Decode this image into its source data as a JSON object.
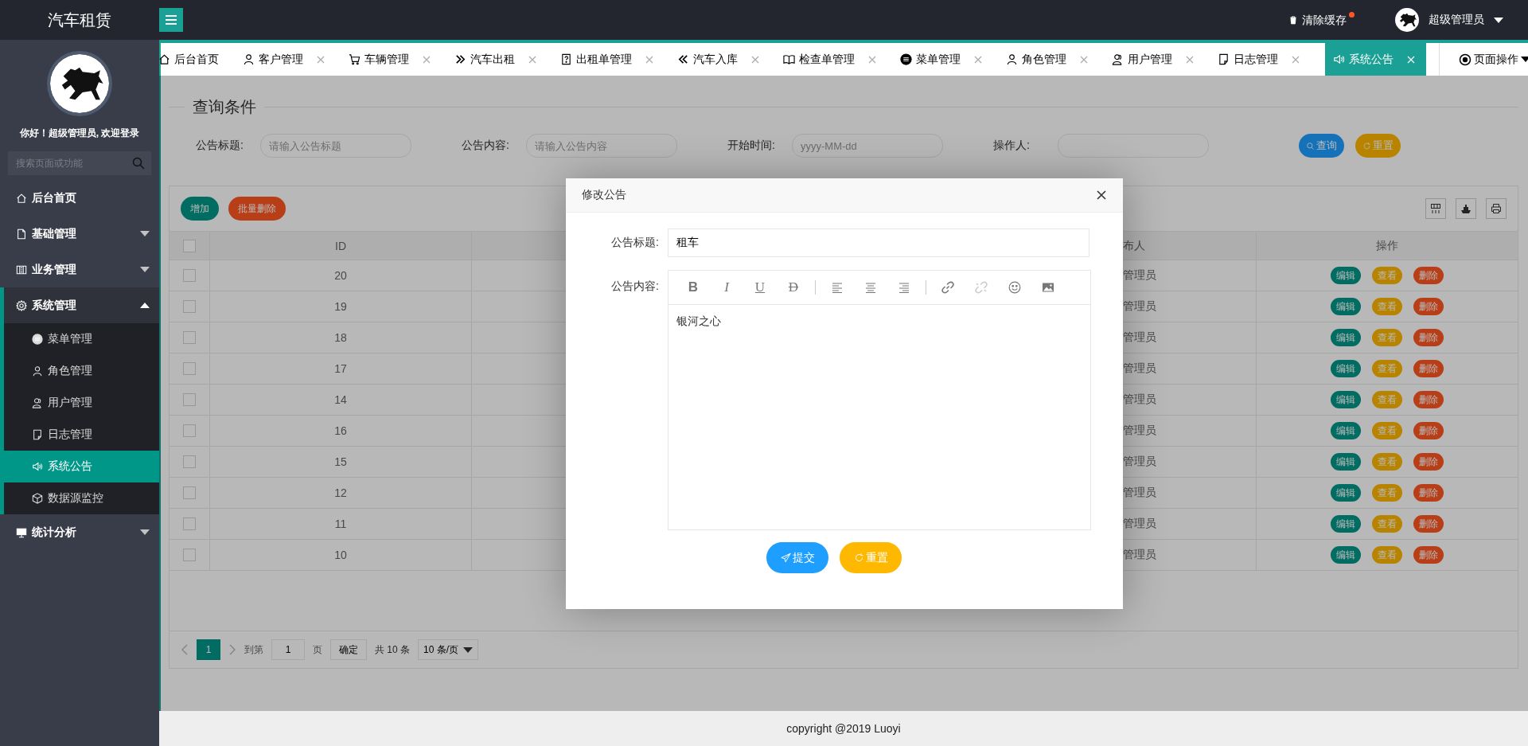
{
  "header": {
    "app_title": "汽车租赁",
    "clear_cache": "清除缓存",
    "user": "超级管理员"
  },
  "tabs": [
    {
      "label": "后台首页",
      "closable": false,
      "selected": false
    },
    {
      "label": "客户管理",
      "closable": true,
      "selected": false
    },
    {
      "label": "车辆管理",
      "closable": true,
      "selected": false
    },
    {
      "label": "汽车出租",
      "closable": true,
      "selected": false
    },
    {
      "label": "出租单管理",
      "closable": true,
      "selected": false
    },
    {
      "label": "汽车入库",
      "closable": true,
      "selected": false
    },
    {
      "label": "检查单管理",
      "closable": true,
      "selected": false
    },
    {
      "label": "菜单管理",
      "closable": true,
      "selected": false
    },
    {
      "label": "角色管理",
      "closable": true,
      "selected": false
    },
    {
      "label": "用户管理",
      "closable": true,
      "selected": false
    },
    {
      "label": "日志管理",
      "closable": true,
      "selected": false
    },
    {
      "label": "系统公告",
      "closable": true,
      "selected": true
    }
  ],
  "page_actions": "页面操作",
  "sidebar": {
    "greeting": "你好！超级管理员, 欢迎登录",
    "search": {
      "placeholder": "搜索页面或功能"
    },
    "items": [
      {
        "label": "后台首页",
        "selected": false
      },
      {
        "label": "基础管理",
        "expanded": false,
        "selected": false
      },
      {
        "label": "业务管理",
        "expanded": false,
        "selected": false
      },
      {
        "label": "系统管理",
        "expanded": true,
        "selected": false,
        "children": [
          {
            "label": "菜单管理",
            "selected": false
          },
          {
            "label": "角色管理",
            "selected": false
          },
          {
            "label": "用户管理",
            "selected": false
          },
          {
            "label": "日志管理",
            "selected": false
          },
          {
            "label": "系统公告",
            "selected": true
          },
          {
            "label": "数据源监控",
            "selected": false
          }
        ]
      },
      {
        "label": "统计分析",
        "expanded": false,
        "selected": false
      }
    ]
  },
  "query": {
    "title": "查询条件",
    "fields": [
      {
        "label": "公告标题:",
        "placeholder": "请输入公告标题"
      },
      {
        "label": "公告内容:",
        "placeholder": "请输入公告内容"
      },
      {
        "label": "开始时间:",
        "placeholder": "yyyy-MM-dd"
      },
      {
        "label": "操作人:"
      }
    ],
    "buttons": [
      {
        "label": "查询",
        "kind": "search"
      },
      {
        "label": "重置",
        "kind": "reset"
      }
    ]
  },
  "table": {
    "toolbar": [
      {
        "label": "增加",
        "kind": "add"
      },
      {
        "label": "批量删除",
        "kind": "delete"
      }
    ],
    "all_checked": false,
    "columns": [
      {
        "label": "ID"
      },
      {
        "label": "布人"
      },
      {
        "label": "操作"
      }
    ],
    "rows": [
      {
        "id": "20",
        "column_3": "管理员",
        "checked": false,
        "actions": [
          "编辑",
          "查看",
          "删除"
        ]
      },
      {
        "id": "19",
        "column_3": "管理员",
        "checked": false,
        "actions": [
          "编辑",
          "查看",
          "删除"
        ]
      },
      {
        "id": "18",
        "column_3": "管理员",
        "checked": false,
        "actions": [
          "编辑",
          "查看",
          "删除"
        ]
      },
      {
        "id": "17",
        "column_3": "管理员",
        "checked": false,
        "actions": [
          "编辑",
          "查看",
          "删除"
        ]
      },
      {
        "id": "14",
        "column_3": "管理员",
        "checked": false,
        "actions": [
          "编辑",
          "查看",
          "删除"
        ]
      },
      {
        "id": "16",
        "column_3": "管理员",
        "checked": false,
        "actions": [
          "编辑",
          "查看",
          "删除"
        ]
      },
      {
        "id": "15",
        "column_3": "管理员",
        "checked": false,
        "actions": [
          "编辑",
          "查看",
          "删除"
        ]
      },
      {
        "id": "12",
        "column_3": "管理员",
        "checked": false,
        "actions": [
          "编辑",
          "查看",
          "删除"
        ]
      },
      {
        "id": "11",
        "column_3": "管理员",
        "checked": false,
        "actions": [
          "编辑",
          "查看",
          "删除"
        ]
      },
      {
        "id": "10",
        "column_3": "管理员",
        "checked": false,
        "actions": [
          "编辑",
          "查看",
          "删除"
        ]
      }
    ],
    "pagination": {
      "pages": [
        {
          "label": "1",
          "selected": true
        }
      ],
      "goto_label": "到第",
      "goto_value": "1",
      "page_unit": "页",
      "confirm": "确定",
      "total": "共 10 条",
      "page_size": "10 条/页"
    }
  },
  "modal": {
    "title": "修改公告",
    "title_label": "公告标题:",
    "title_value": "租车",
    "content_label": "公告内容:",
    "content_value": "银河之心",
    "tool_groups": [
      [
        {
          "kind": "bold",
          "label": "B",
          "disabled": false
        },
        {
          "kind": "italic",
          "label": "I",
          "disabled": false
        },
        {
          "kind": "underline",
          "label": "U",
          "disabled": false
        },
        {
          "kind": "strike",
          "label": "D",
          "disabled": false
        }
      ],
      [
        {
          "kind": "align-left",
          "disabled": false
        },
        {
          "kind": "align-center",
          "disabled": false
        },
        {
          "kind": "align-right",
          "disabled": false
        }
      ],
      [
        {
          "kind": "link",
          "disabled": false
        },
        {
          "kind": "unlink",
          "disabled": true
        },
        {
          "kind": "emoji",
          "disabled": false
        },
        {
          "kind": "image",
          "disabled": false
        }
      ]
    ],
    "buttons": [
      {
        "label": "提交",
        "kind": "submit"
      },
      {
        "label": "重置",
        "kind": "reset"
      }
    ]
  },
  "footer": "copyright @2019 Luoyi"
}
